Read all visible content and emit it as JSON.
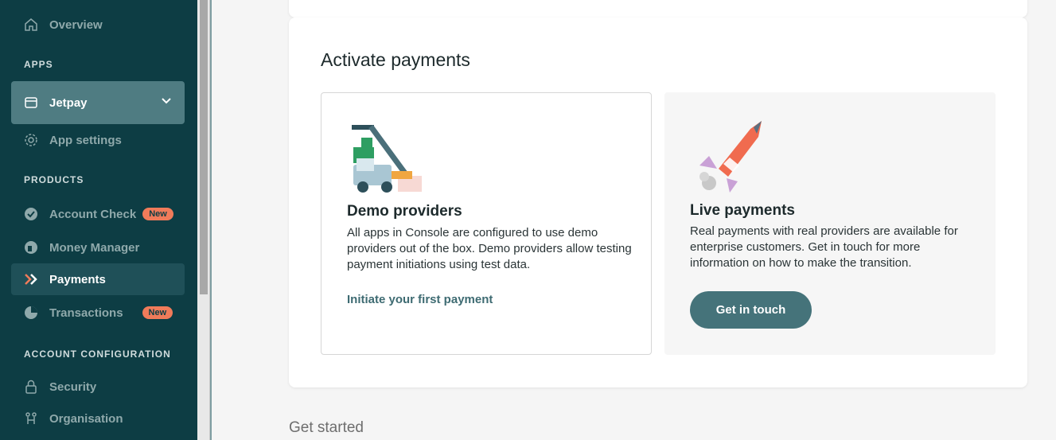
{
  "sidebar": {
    "overview": "Overview",
    "apps_label": "APPS",
    "app_name": "Jetpay",
    "app_settings": "App settings",
    "products_label": "PRODUCTS",
    "account_check": "Account Check",
    "account_check_badge": "New",
    "money_manager": "Money Manager",
    "payments": "Payments",
    "transactions": "Transactions",
    "transactions_badge": "New",
    "account_config_label": "ACCOUNT CONFIGURATION",
    "security": "Security",
    "organisation": "Organisation"
  },
  "main": {
    "title": "Activate payments",
    "demo": {
      "title": "Demo providers",
      "description": "All apps in Console are configured to use demo providers out of the box. Demo providers allow testing payment initiations using test data.",
      "link": "Initiate your first payment"
    },
    "live": {
      "title": "Live payments",
      "description": "Real payments with real providers are available for enterprise customers. Get in touch for more information on how to make the transition.",
      "button": "Get in touch"
    },
    "get_started": "Get started"
  },
  "colors": {
    "sidebar_bg": "#0d3d44",
    "active_bg": "#1f5058",
    "app_bg": "#4f7c82",
    "badge": "#f07b5a",
    "cta": "#45737a",
    "link": "#3e6b72"
  },
  "icons": [
    "home-icon",
    "app-window-icon",
    "chevron-down-icon",
    "gear-icon",
    "check-badge-icon",
    "money-manager-icon",
    "payments-arrow-icon",
    "transactions-icon",
    "lock-icon",
    "organisation-icon",
    "crane-truck-illustration",
    "rocket-illustration"
  ]
}
